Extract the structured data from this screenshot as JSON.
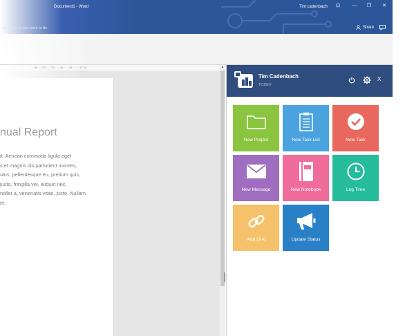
{
  "titlebar": {
    "title": "Document1  -  Word",
    "user": "Tim cadenbach",
    "tellme": "do ue ali at you want to do",
    "share_label": "Share",
    "minimize": "—",
    "restore": "❐",
    "close": "✕",
    "ribbon_display": "⊡"
  },
  "ruler": {
    "text": "· 8 · · · 10 · · · 12 · · · 14 · · · 16 · · · · 17 18"
  },
  "document": {
    "title": "nual Report",
    "body_lines": [
      "it. Aenean commodo ligula eget",
      "s et magnis dis parturient montes,",
      "ulus, pellentesque eu, pretium quis,",
      "justo, fringilla vel, aliquet nec,",
      "nollet a, venenatis vitae, justo. Nullam",
      "et."
    ]
  },
  "panel": {
    "user_name": "Tim Cadenbach",
    "org": "TCDEV",
    "close_label": "X",
    "tiles": [
      {
        "label": "New Project",
        "color": "#8bc53f",
        "icon": "folder-icon"
      },
      {
        "label": "New Task List",
        "color": "#4aa3df",
        "icon": "clipboard-icon"
      },
      {
        "label": "New Task",
        "color": "#e8685d",
        "icon": "checkmark-icon"
      },
      {
        "label": "New Message",
        "color": "#9f6ec0",
        "icon": "envelope-icon"
      },
      {
        "label": "New Notebook",
        "color": "#f06c9b",
        "icon": "notebook-icon"
      },
      {
        "label": "Log Time",
        "color": "#26bc9c",
        "icon": "clock-icon"
      },
      {
        "label": "Add Link",
        "color": "#f5c16b",
        "icon": "link-icon"
      },
      {
        "label": "Update Status",
        "color": "#2980c6",
        "icon": "megaphone-icon"
      }
    ]
  }
}
